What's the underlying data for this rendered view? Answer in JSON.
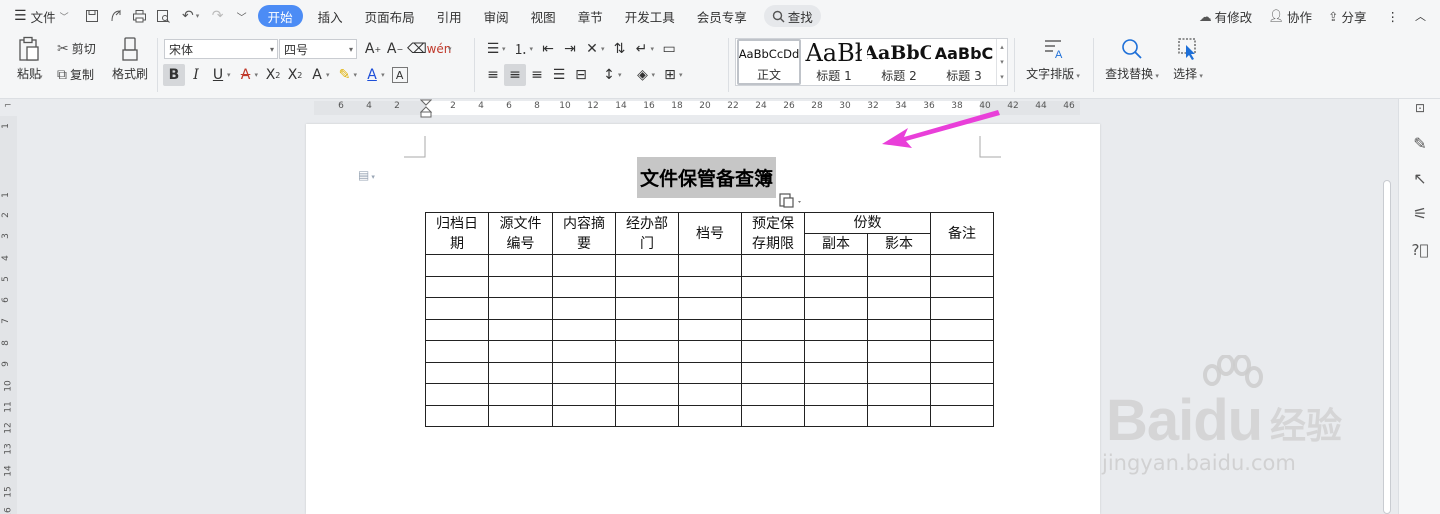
{
  "menubar": {
    "file_label": "文件",
    "tabs": [
      "开始",
      "插入",
      "页面布局",
      "引用",
      "审阅",
      "视图",
      "章节",
      "开发工具",
      "会员专享"
    ],
    "search_label": "查找",
    "right": {
      "changes": "有修改",
      "collab": "协作",
      "share": "分享"
    }
  },
  "ribbon": {
    "paste": "粘贴",
    "cut": "剪切",
    "copy": "复制",
    "format_painter": "格式刷",
    "font_name": "宋体",
    "font_size": "四号",
    "styles": [
      {
        "sample": "AaBbCcDd",
        "label": "正文"
      },
      {
        "sample": "AaBł",
        "label": "标题 1"
      },
      {
        "sample": "AaBbC",
        "label": "标题 2"
      },
      {
        "sample": "AaBbC",
        "label": "标题 3"
      }
    ],
    "text_layout": "文字排版",
    "find_replace": "查找替换",
    "select": "选择"
  },
  "ruler": {
    "h_ticks": [
      "6",
      "4",
      "2",
      "2",
      "4",
      "6",
      "8",
      "10",
      "12",
      "14",
      "16",
      "18",
      "20",
      "22",
      "24",
      "26",
      "28",
      "30",
      "32",
      "34",
      "36",
      "38",
      "40",
      "42",
      "44",
      "46"
    ],
    "v_ticks": [
      "1",
      "1",
      "2",
      "3",
      "4",
      "5",
      "6",
      "7",
      "8",
      "9",
      "10",
      "11",
      "12",
      "13",
      "14",
      "15",
      "16"
    ]
  },
  "document": {
    "title": "文件保管备查簿",
    "table": {
      "headers": [
        "归档日期",
        "源文件编号",
        "内容摘要",
        "经办部门",
        "档号",
        "预定保存期限",
        "份数",
        "备注"
      ],
      "header_lines": [
        [
          "归档日",
          "期"
        ],
        [
          "源文件",
          "编号"
        ],
        [
          "内容摘",
          "要"
        ],
        [
          "经办部",
          "门"
        ],
        [
          "档号"
        ],
        [
          "预定保",
          "存期限"
        ]
      ],
      "sub_headers": [
        "副本",
        "影本"
      ],
      "empty_rows": 8
    }
  },
  "watermark": {
    "logo": "Baidu",
    "cn": "经验",
    "url": "jingyan.baidu.com"
  },
  "colors": {
    "accent": "#4c8cf5",
    "arrow": "#e93fd9",
    "title_highlight": "#c6c6c6"
  }
}
